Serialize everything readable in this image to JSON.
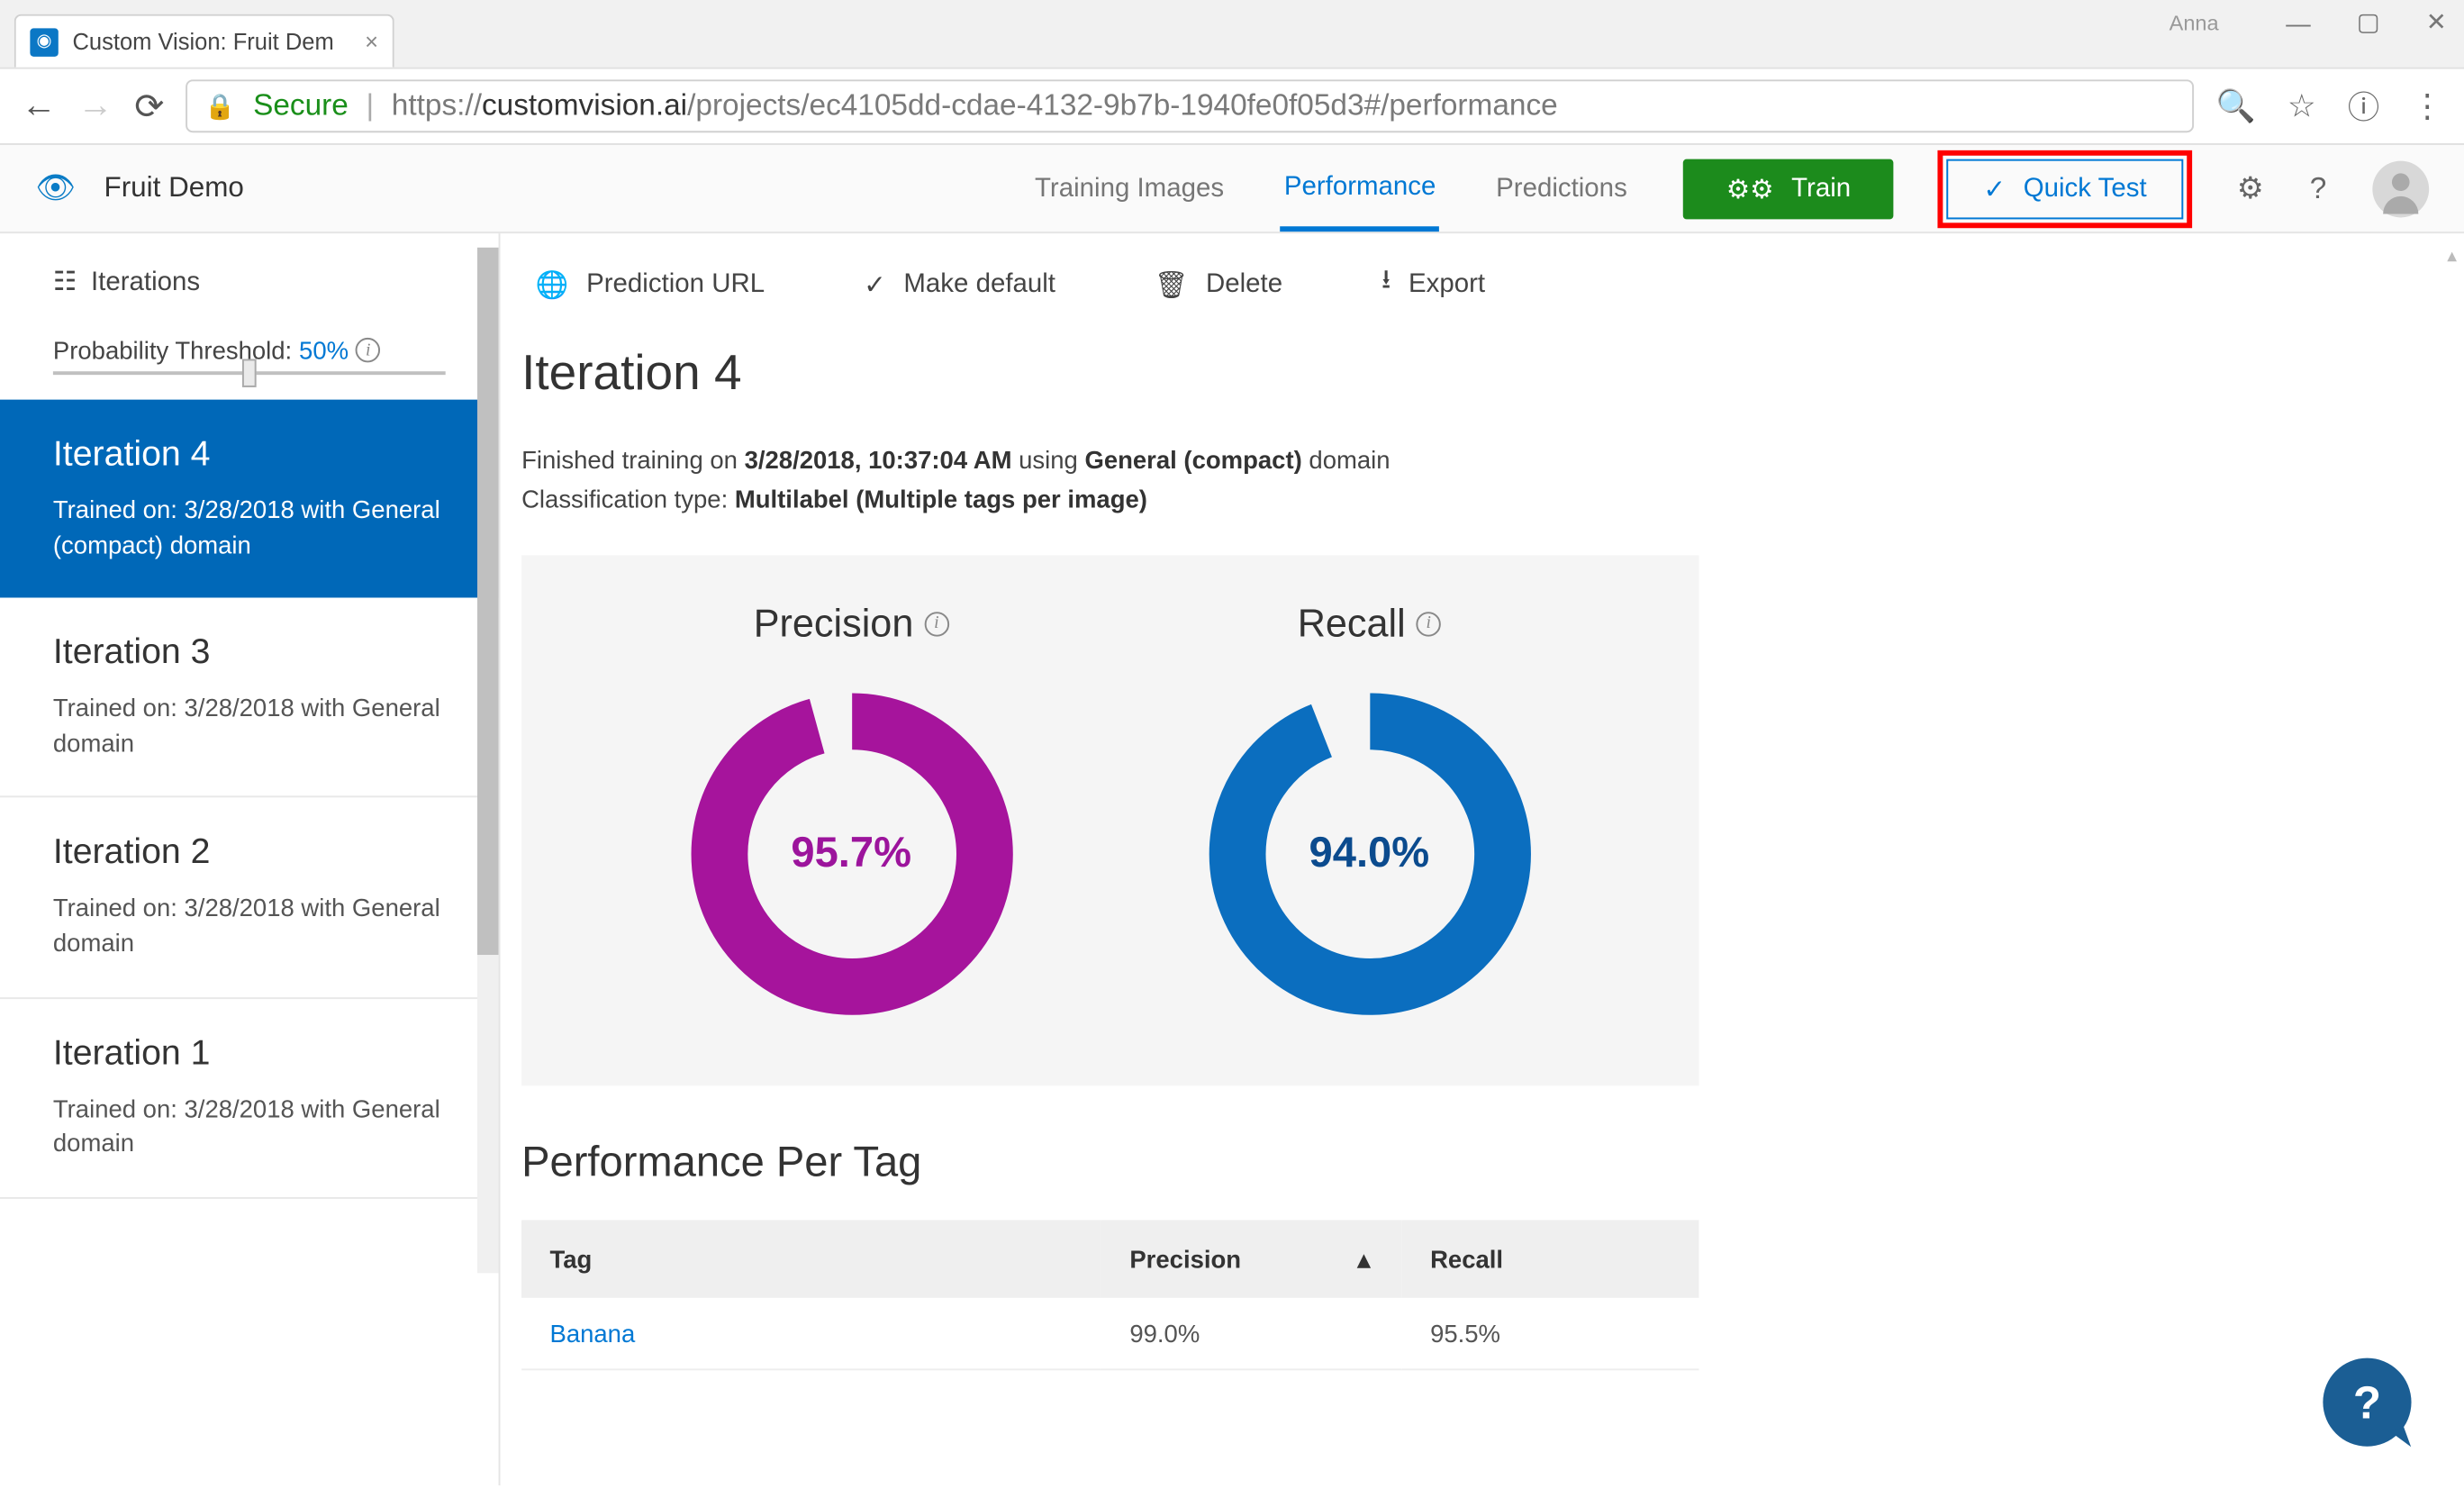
{
  "browser": {
    "tab_title": "Custom Vision: Fruit Dem",
    "user": "Anna",
    "secure_label": "Secure",
    "url_host": "customvision.ai",
    "url_path": "/projects/ec4105dd-cdae-4132-9b7b-1940fe0f05d3#/performance",
    "url_scheme": "https://"
  },
  "header": {
    "project_name": "Fruit Demo",
    "tabs": {
      "training": "Training Images",
      "performance": "Performance",
      "predictions": "Predictions"
    },
    "train_btn": "Train",
    "quick_btn": "Quick Test"
  },
  "sidebar": {
    "iterations_label": "Iterations",
    "threshold_label": "Probability Threshold:",
    "threshold_value": "50%",
    "items": [
      {
        "title": "Iteration 4",
        "sub": "Trained on: 3/28/2018 with General (compact) domain",
        "selected": true
      },
      {
        "title": "Iteration 3",
        "sub": "Trained on: 3/28/2018 with General domain",
        "selected": false
      },
      {
        "title": "Iteration 2",
        "sub": "Trained on: 3/28/2018 with General domain",
        "selected": false
      },
      {
        "title": "Iteration 1",
        "sub": "Trained on: 3/28/2018 with General domain",
        "selected": false
      }
    ]
  },
  "toolbar": {
    "pred_url": "Prediction URL",
    "make_default": "Make default",
    "delete": "Delete",
    "export": "Export"
  },
  "main": {
    "title": "Iteration 4",
    "finished_prefix": "Finished training on ",
    "finished_time": "3/28/2018, 10:37:04 AM",
    "finished_mid": " using ",
    "domain": "General (compact)",
    "finished_suffix": " domain",
    "class_prefix": "Classification type: ",
    "class_type": "Multilabel (Multiple tags per image)",
    "precision_label": "Precision",
    "recall_label": "Recall",
    "precision_pct": "95.7%",
    "recall_pct": "94.0%",
    "ppt_title": "Performance Per Tag",
    "table": {
      "h_tag": "Tag",
      "h_prec": "Precision",
      "h_rec": "Recall",
      "rows": [
        {
          "tag": "Banana",
          "precision": "99.0%",
          "recall": "95.5%"
        }
      ]
    }
  },
  "chart_data": [
    {
      "type": "pie",
      "title": "Precision",
      "series": [
        {
          "name": "Precision",
          "values": [
            95.7
          ]
        }
      ],
      "values": [
        95.7,
        4.3
      ],
      "ylim": [
        0,
        100
      ],
      "color": "#a6149c"
    },
    {
      "type": "pie",
      "title": "Recall",
      "series": [
        {
          "name": "Recall",
          "values": [
            94.0
          ]
        }
      ],
      "values": [
        94.0,
        6.0
      ],
      "ylim": [
        0,
        100
      ],
      "color": "#0b6ebf"
    }
  ]
}
